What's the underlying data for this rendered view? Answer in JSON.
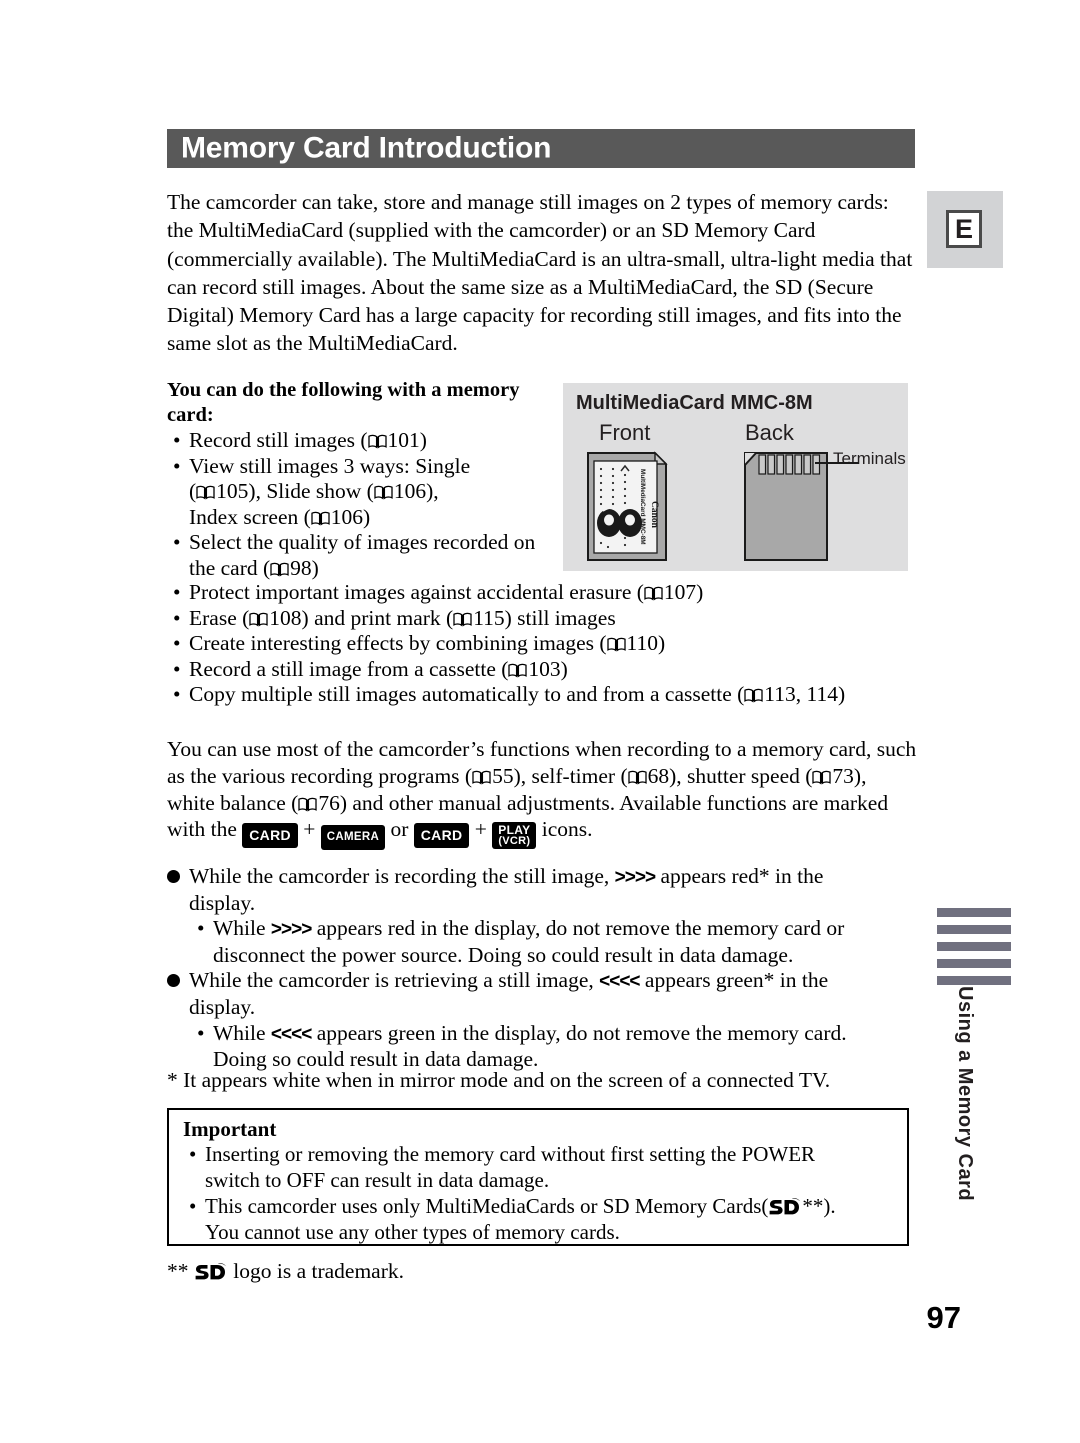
{
  "header": {
    "title": "Memory Card Introduction",
    "language_badge": "E"
  },
  "intro": {
    "paragraph": "The camcorder can take, store and manage still images on 2 types of memory cards: the MultiMediaCard (supplied with the camcorder) or an SD Memory Card (commercially available). The MultiMediaCard is an ultra-small, ultra-light media that can record still images. About the same size as a MultiMediaCard, the SD (Secure Digital) Memory Card has a large capacity for recording still images, and fits into the same slot as the MultiMediaCard."
  },
  "capabilities": {
    "lead": "You can do the following with a memory card:",
    "bullet_char": "•",
    "items_narrow": [
      "Record still images (",
      "View still images 3 ways: Single (",
      "Select the quality of images recorded on the card ("
    ],
    "narrow_text": {
      "b1_a": "Record still images (",
      "b1_ref": "101",
      "b1_b": ")",
      "b2_a": "View still images 3 ways: Single",
      "b2_b": "(",
      "b2_ref1": "105",
      "b2_c": "), Slide show (",
      "b2_ref2": "106",
      "b2_d": "),",
      "b2_e": "Index screen (",
      "b2_ref3": "106",
      "b2_f": ")",
      "b3_a": "Select the quality of images recorded on",
      "b3_b": "the card (",
      "b3_ref": "98",
      "b3_c": ")"
    },
    "wide_text": {
      "b4_a": "Protect important images against accidental erasure (",
      "b4_ref": "107",
      "b4_b": ")",
      "b5_a": "Erase (",
      "b5_ref1": "108",
      "b5_b": ") and print mark (",
      "b5_ref2": "115",
      "b5_c": ") still images",
      "b6_a": "Create interesting effects by combining images (",
      "b6_ref": "110",
      "b6_b": ")",
      "b7_a": "Record a still image from a cassette (",
      "b7_ref": "103",
      "b7_b": ")",
      "b8_a": "Copy multiple still images automatically to and from a cassette (",
      "b8_ref": "113, 114",
      "b8_b": ")"
    }
  },
  "figure": {
    "title": "MultiMediaCard MMC-8M",
    "caption_front": "Front",
    "caption_back": "Back",
    "terminals_label": "Terminals",
    "card_label_line1": "MultiMediaCard MMC-8M",
    "card_brand": "Canon",
    "panel_bg": "#dededf"
  },
  "functions_paragraph": {
    "p1": "You can use most of the camcorder’s functions when recording to a memory card, such as the various recording programs (",
    "ref1": "55",
    "p2": "), self-timer (",
    "ref2": "68",
    "p3": "), shutter speed (",
    "ref3": "73",
    "p4": "), white balance (",
    "ref4": "76",
    "p5": ") and other manual adjustments. Available functions are marked with the",
    "badge_card": "CARD",
    "plus": "+",
    "badge_camera": "CAMERA",
    "or": "or",
    "badge_card2": "CARD",
    "badge_play_line1": "PLAY",
    "badge_play_line2": "(VCR)",
    "p6": "icons."
  },
  "notes": {
    "rec_a": "While the camcorder is recording the still image,",
    "rec_arrows": ">>>>",
    "rec_b": "appears red* in the",
    "rec_c": "display.",
    "rec_sub_a": "While",
    "rec_sub_arrows": ">>>>",
    "rec_sub_b": "appears red in the display, do not remove the memory card or",
    "rec_sub_c": "disconnect the power source. Doing so could result in data damage.",
    "ret_a": "While the camcorder is retrieving a still image,",
    "ret_arrows": "<<<<",
    "ret_b": "appears green* in the",
    "ret_c": "display.",
    "ret_sub_a": "While",
    "ret_sub_arrows": "<<<<",
    "ret_sub_b": "appears green in the display, do not remove the memory card.",
    "ret_sub_c": "Doing so could result in data damage.",
    "footnote": "* It appears white when in mirror mode and on the screen of a connected TV."
  },
  "important": {
    "title": "Important",
    "item1_a": "Inserting or removing the memory card without first setting the POWER",
    "item1_b": "switch to OFF can result in data damage.",
    "item2_a": "This camcorder uses only MultiMediaCards or SD Memory Cards(",
    "item2_b": "**).",
    "item2_c": "You cannot use any other types of memory cards."
  },
  "trademark": {
    "stars": "**",
    "text": "logo is a trademark."
  },
  "margin_tab": {
    "label": "Using a Memory Card",
    "bar_count": 5,
    "bar_color": "#70707f"
  },
  "page_number": "97"
}
